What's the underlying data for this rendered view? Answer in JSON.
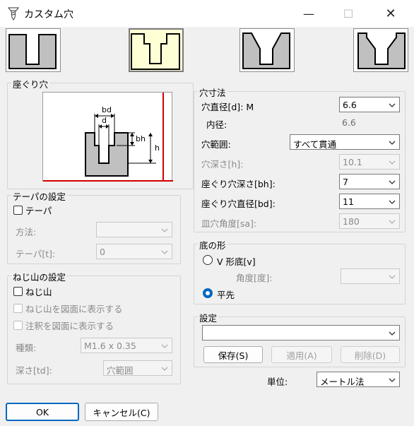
{
  "window": {
    "title": "カスタム穴",
    "minimize_glyph": "—",
    "maximize_glyph": "☐",
    "close_glyph": "✕"
  },
  "counterbore": {
    "group_title": "座ぐり穴",
    "diagram": {
      "bd": "bd",
      "d": "d",
      "bh": "bh",
      "h": "h"
    }
  },
  "taper": {
    "group_title": "テーパの設定",
    "checkbox_label": "テーパ",
    "method_label": "方法:",
    "method_value": "",
    "taper_label": "テーパ[t]:",
    "taper_value": "0"
  },
  "thread": {
    "group_title": "ねじ山の設定",
    "thread_checkbox": "ねじ山",
    "show_thread_checkbox": "ねじ山を図面に表示する",
    "show_note_checkbox": "注釈を図面に表示する",
    "type_label": "種類:",
    "type_value": "M1.6 x 0.35",
    "depth_label": "深さ[td]:",
    "depth_value": "穴範囲"
  },
  "dimensions": {
    "group_title": "穴寸法",
    "diameter_label": "穴直径[d]: M",
    "diameter_value": "6.6",
    "inner_label": "内径:",
    "inner_value": "6.6",
    "range_label": "穴範囲:",
    "range_value": "すべて貫通",
    "depth_label": "穴深さ[h]:",
    "depth_value": "10.1",
    "cb_depth_label": "座ぐり穴深さ[bh]:",
    "cb_depth_value": "7",
    "cb_diameter_label": "座ぐり穴直径[bd]:",
    "cb_diameter_value": "11",
    "cs_angle_label": "皿穴角度[sa]:",
    "cs_angle_value": "180"
  },
  "bottom": {
    "group_title": "底の形",
    "v_label": "V 形底[v]",
    "angle_label": "角度[度]:",
    "angle_value": "",
    "flat_label": "平先"
  },
  "settings": {
    "group_title": "設定",
    "preset_value": "",
    "save": "保存(S)",
    "apply": "適用(A)",
    "delete": "削除(D)"
  },
  "unit": {
    "label": "単位:",
    "value": "メートル法"
  },
  "footer": {
    "ok": "OK",
    "cancel": "キャンセル(C)"
  },
  "colors": {
    "accent": "#0067c0",
    "selected_tile": "#ffffd6",
    "part_fill": "#c0c0c0",
    "preview_border_red": "#d00000"
  }
}
